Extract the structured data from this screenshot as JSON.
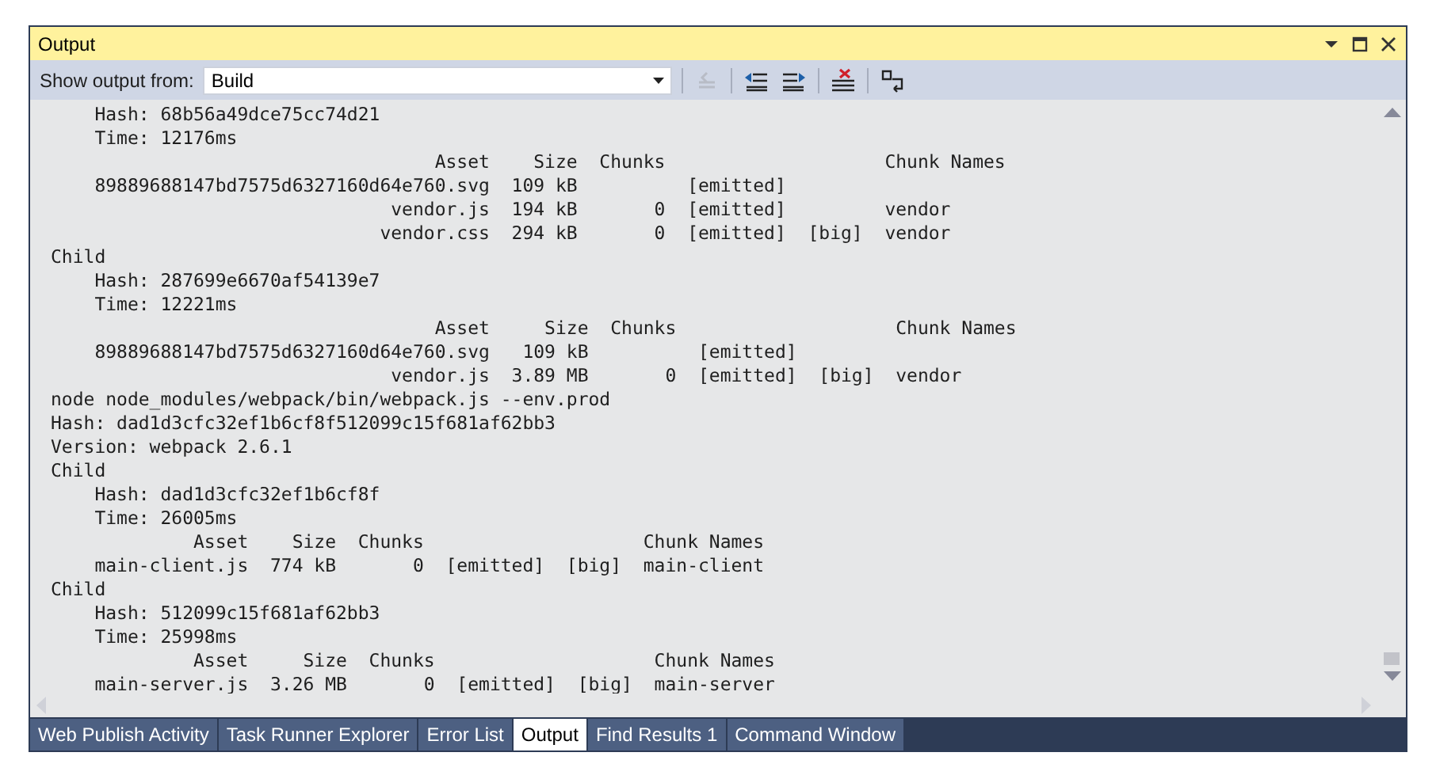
{
  "window": {
    "title": "Output"
  },
  "toolbar": {
    "label": "Show output from:",
    "source": "Build"
  },
  "output": {
    "lines": [
      "    Hash: 68b56a49dce75cc74d21",
      "    Time: 12176ms",
      "                                   Asset    Size  Chunks                    Chunk Names",
      "    89889688147bd7575d6327160d64e760.svg  109 kB          [emitted]",
      "                               vendor.js  194 kB       0  [emitted]         vendor",
      "                              vendor.css  294 kB       0  [emitted]  [big]  vendor",
      "Child",
      "    Hash: 287699e6670af54139e7",
      "    Time: 12221ms",
      "                                   Asset     Size  Chunks                    Chunk Names",
      "    89889688147bd7575d6327160d64e760.svg   109 kB          [emitted]",
      "                               vendor.js  3.89 MB       0  [emitted]  [big]  vendor",
      "node node_modules/webpack/bin/webpack.js --env.prod",
      "Hash: dad1d3cfc32ef1b6cf8f512099c15f681af62bb3",
      "Version: webpack 2.6.1",
      "Child",
      "    Hash: dad1d3cfc32ef1b6cf8f",
      "    Time: 26005ms",
      "             Asset    Size  Chunks                    Chunk Names",
      "    main-client.js  774 kB       0  [emitted]  [big]  main-client",
      "Child",
      "    Hash: 512099c15f681af62bb3",
      "    Time: 25998ms",
      "             Asset     Size  Chunks                    Chunk Names",
      "    main-server.js  3.26 MB       0  [emitted]  [big]  main-server"
    ]
  },
  "tabs": [
    {
      "label": "Web Publish Activity",
      "selected": false
    },
    {
      "label": "Task Runner Explorer",
      "selected": false
    },
    {
      "label": "Error List",
      "selected": false
    },
    {
      "label": "Output",
      "selected": true
    },
    {
      "label": "Find Results 1",
      "selected": false
    },
    {
      "label": "Command Window",
      "selected": false
    }
  ]
}
